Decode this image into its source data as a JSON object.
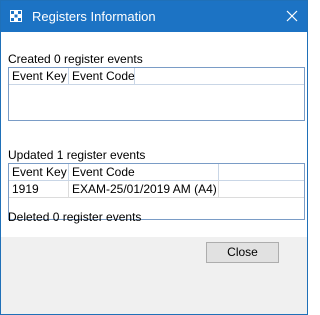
{
  "window": {
    "title": "Registers Information"
  },
  "created": {
    "label": "Created 0 register events",
    "columns": [
      "Event Key",
      "Event Code"
    ],
    "rows": []
  },
  "updated": {
    "label": "Updated 1 register events",
    "columns": [
      "Event Key",
      "Event Code"
    ],
    "rows": [
      {
        "key": "1919",
        "code": "EXAM-25/01/2019 AM (A4)"
      }
    ]
  },
  "deleted": {
    "label": "Deleted 0 register events"
  },
  "buttons": {
    "close": "Close"
  },
  "colors": {
    "titlebar": "#1c73c4",
    "border": "#1f70b8"
  }
}
